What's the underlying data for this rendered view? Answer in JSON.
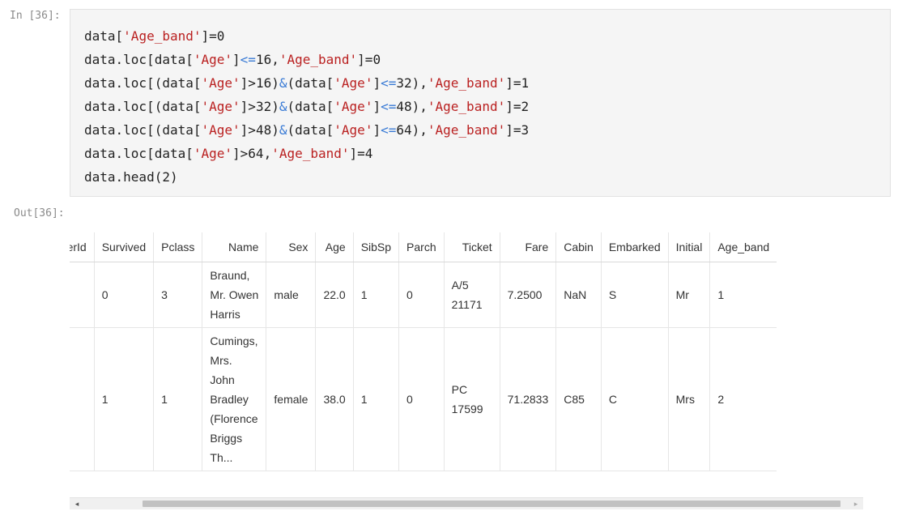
{
  "cell": {
    "in_prompt": "In [36]:",
    "out_prompt": "Out[36]:"
  },
  "code_lines": [
    [
      [
        "data[",
        "p"
      ],
      [
        "'Age_band'",
        "s"
      ],
      [
        "]=0",
        "p"
      ]
    ],
    [
      [
        "data.loc[data[",
        "p"
      ],
      [
        "'Age'",
        "s"
      ],
      [
        "]",
        "p"
      ],
      [
        "<=",
        "o"
      ],
      [
        "16,",
        "p"
      ],
      [
        "'Age_band'",
        "s"
      ],
      [
        "]=0",
        "p"
      ]
    ],
    [
      [
        "data.loc[(data[",
        "p"
      ],
      [
        "'Age'",
        "s"
      ],
      [
        "]>16)",
        "p"
      ],
      [
        "&",
        "o"
      ],
      [
        "(data[",
        "p"
      ],
      [
        "'Age'",
        "s"
      ],
      [
        "]",
        "p"
      ],
      [
        "<=",
        "o"
      ],
      [
        "32),",
        "p"
      ],
      [
        "'Age_band'",
        "s"
      ],
      [
        "]=1",
        "p"
      ]
    ],
    [
      [
        "data.loc[(data[",
        "p"
      ],
      [
        "'Age'",
        "s"
      ],
      [
        "]>32)",
        "p"
      ],
      [
        "&",
        "o"
      ],
      [
        "(data[",
        "p"
      ],
      [
        "'Age'",
        "s"
      ],
      [
        "]",
        "p"
      ],
      [
        "<=",
        "o"
      ],
      [
        "48),",
        "p"
      ],
      [
        "'Age_band'",
        "s"
      ],
      [
        "]=2",
        "p"
      ]
    ],
    [
      [
        "data.loc[(data[",
        "p"
      ],
      [
        "'Age'",
        "s"
      ],
      [
        "]>48)",
        "p"
      ],
      [
        "&",
        "o"
      ],
      [
        "(data[",
        "p"
      ],
      [
        "'Age'",
        "s"
      ],
      [
        "]",
        "p"
      ],
      [
        "<=",
        "o"
      ],
      [
        "64),",
        "p"
      ],
      [
        "'Age_band'",
        "s"
      ],
      [
        "]=3",
        "p"
      ]
    ],
    [
      [
        "data.loc[data[",
        "p"
      ],
      [
        "'Age'",
        "s"
      ],
      [
        "]>64,",
        "p"
      ],
      [
        "'Age_band'",
        "s"
      ],
      [
        "]=4",
        "p"
      ]
    ],
    [
      [
        "data.head(2)",
        "p"
      ]
    ]
  ],
  "table": {
    "columns": [
      "ngerId",
      "Survived",
      "Pclass",
      "Name",
      "Sex",
      "Age",
      "SibSp",
      "Parch",
      "Ticket",
      "Fare",
      "Cabin",
      "Embarked",
      "Initial",
      "Age_band"
    ],
    "rows": [
      [
        "",
        "0",
        "3",
        "Braund, Mr. Owen Harris",
        "male",
        "22.0",
        "1",
        "0",
        "A/5 21171",
        "7.2500",
        "NaN",
        "S",
        "Mr",
        "1"
      ],
      [
        "",
        "1",
        "1",
        "Cumings, Mrs. John Bradley (Florence Briggs Th...",
        "female",
        "38.0",
        "1",
        "0",
        "PC 17599",
        "71.2833",
        "C85",
        "C",
        "Mrs",
        "2"
      ]
    ]
  },
  "scrollbar": {
    "left_arrow": "◂",
    "right_arrow": "▸"
  },
  "colors": {
    "string": "#ba2121",
    "operator": "#3a7bd5",
    "input_bg": "#f5f5f5"
  }
}
